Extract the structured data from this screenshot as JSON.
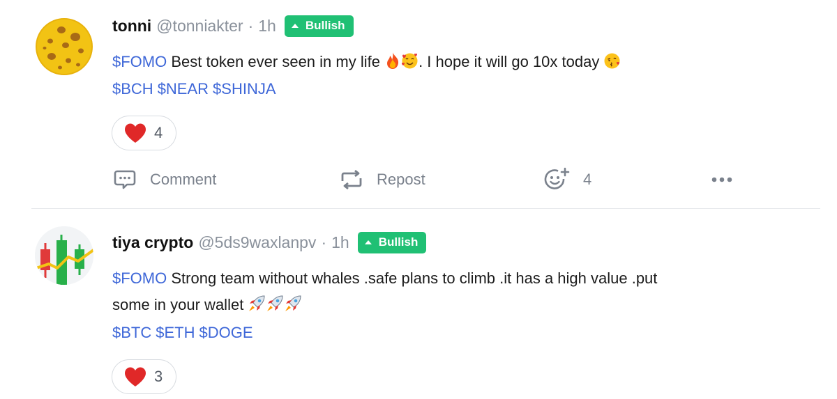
{
  "posts": [
    {
      "name": "tonni",
      "handle": "@tonniakter",
      "separator": "·",
      "time": "1h",
      "badge": "Bullish",
      "body_cashtag": "$FOMO",
      "body_text": "Best token ever seen in my life",
      "body_text_after": ". I hope it will go 10x today",
      "tags": [
        "$BCH",
        "$NEAR",
        "$SHINJA"
      ],
      "likes": "4",
      "actions": {
        "comment": "Comment",
        "repost": "Repost",
        "reactions_count": "4"
      }
    },
    {
      "name": "tiya crypto",
      "handle": "@5ds9waxlanpv",
      "separator": "·",
      "time": "1h",
      "badge": "Bullish",
      "body_cashtag": "$FOMO",
      "body_line1": "Strong team without whales .safe plans to climb .it has a high value .put",
      "body_line2": "some in your wallet",
      "tags": [
        "$BTC",
        "$ETH",
        "$DOGE"
      ],
      "likes": "3"
    }
  ],
  "colors": {
    "bullish": "#20c074",
    "cashtag": "#3e67d8",
    "muted": "#8a919b"
  }
}
